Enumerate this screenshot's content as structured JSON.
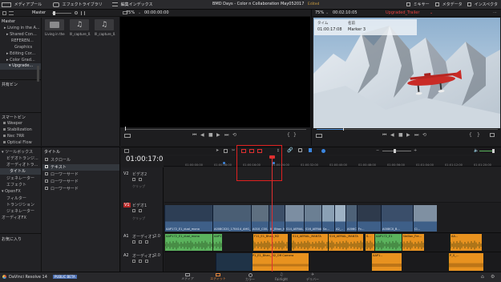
{
  "top_bar": {
    "media_pool": "メディアプール",
    "effects_library": "エフェクトライブラリ",
    "edit_index": "編集インデックス",
    "project_title": "BMD Days - Color n Collaboration May052017",
    "edited_label": "Edited",
    "mixer": "ミキサー",
    "metadata": "メタデータ",
    "inspector": "インスペクタ"
  },
  "media_pool": {
    "bin_selector": "Master",
    "master_label": "Master",
    "tree_items": [
      "Living in the A...",
      "Shared Con...",
      "REFEREN...",
      "Graphics",
      "Editing Cor...",
      "Color Grad...",
      "Upgrade..."
    ],
    "thumbs": [
      "Living in the A...",
      "Ill_capture_0...",
      "Ill_capture_0..."
    ],
    "shared_bins_title": "共有ビン",
    "smart_bins_title": "スマートビン",
    "smart_items": [
      "Weeper",
      "Stabilization",
      "Nec 7RR",
      "Optical Flow"
    ]
  },
  "source_viewer": {
    "zoom": "75%",
    "timecode": "00:00:00:00"
  },
  "timeline_viewer": {
    "zoom": "75%",
    "timecode": "00:02:10:05",
    "dropdown": "Upgraded_Trailer",
    "marker_header_col1": "タイム",
    "marker_header_col2": "名前",
    "marker_time": "01:00:17:08",
    "marker_name": "Marker 3"
  },
  "effects_panel": {
    "tree_title": "ツールボックス",
    "tree_items": [
      "ビデオトランジ...",
      "オーディオトラ...",
      "タイトル",
      "ジェネレーター",
      "エフェクト",
      "OpenFX",
      "フィルター",
      "トランジション",
      "ジェネレーター",
      "オーディオFX"
    ],
    "selected_index": 2,
    "list_title": "タイトル",
    "list_items": [
      "スクロール",
      "テキスト",
      "ローワーサード",
      "ローワーサード",
      "ローワーサード"
    ],
    "selected_item": 1,
    "favorites_title": "お気に入り"
  },
  "timeline": {
    "timecode": "01:00:17:08",
    "ruler_labels": [
      "01:00:00:00",
      "01:00:08:00",
      "01:00:16:00",
      "01:00:24:00",
      "01:00:32:00",
      "01:00:40:00",
      "01:00:48:00",
      "01:00:56:00",
      "01:01:04:00",
      "01:01:12:00",
      "01:01:20:00"
    ],
    "tracks": {
      "v2": {
        "id": "V2",
        "name": "ビデオ2",
        "sub": "クリップ"
      },
      "v1": {
        "id": "V1",
        "name": "ビデオ1",
        "sub": "クリップ"
      },
      "a1": {
        "id": "A1",
        "name": "オーディオ1",
        "level": "2.0"
      },
      "a2": {
        "id": "A2",
        "name": "オーディオ2",
        "level": "2.0"
      }
    },
    "video_clip_names": [
      "AAP172_E1_dual_mono",
      "A008C020_170414_AHG_...",
      "A010_C00...",
      "Ilf_Bhan_M2...",
      "S14_AERIAL_MANTA...",
      "S16_AERIAL_MANT...",
      "Sa...",
      "A2_..",
      "A006C...",
      "Fc...",
      "A008C0_B...",
      "Cl..."
    ],
    "audio_clip_names_a1": [
      "AAP172_E1_dual_mono",
      "AAP17...",
      "F11_E1_Bhan_M2",
      "S14_AERIAL_MANTA",
      "S16_AERIAL_MANTA",
      "S...",
      "AAP172_E1",
      "Neillon_Fre...",
      "AA..."
    ],
    "audio_clip_names_a2": [
      "P1_E1_Bhan_M2_Off Camera",
      "AAP1..",
      "P_S_..."
    ]
  },
  "bottom_bar": {
    "app_name": "DaVinci Resolve 14",
    "badge": "PUBLIC BETA",
    "pages": [
      "メディア",
      "エディット",
      "カラー",
      "Fairlight",
      "デリバー"
    ],
    "active_page": 1
  },
  "colors": {
    "accent_red": "#e03030",
    "video_clip": "#3e5f88",
    "audio_green": "#5bb35d",
    "audio_orange": "#e8921f",
    "active_page": "#e7873b"
  }
}
